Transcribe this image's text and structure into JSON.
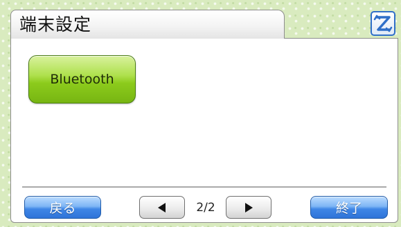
{
  "header": {
    "title": "端末設定"
  },
  "main": {
    "buttons": [
      {
        "label": "Bluetooth"
      }
    ]
  },
  "footer": {
    "back_label": "戻る",
    "page_indicator": "2/2",
    "end_label": "終了"
  },
  "icons": {
    "prev": "triangle-left-icon",
    "next": "triangle-right-icon",
    "corner": "screen-switch-icon"
  },
  "colors": {
    "accent_green": "#8ccb1c",
    "accent_blue": "#3f86e6",
    "background_green": "#d9ebbf"
  }
}
